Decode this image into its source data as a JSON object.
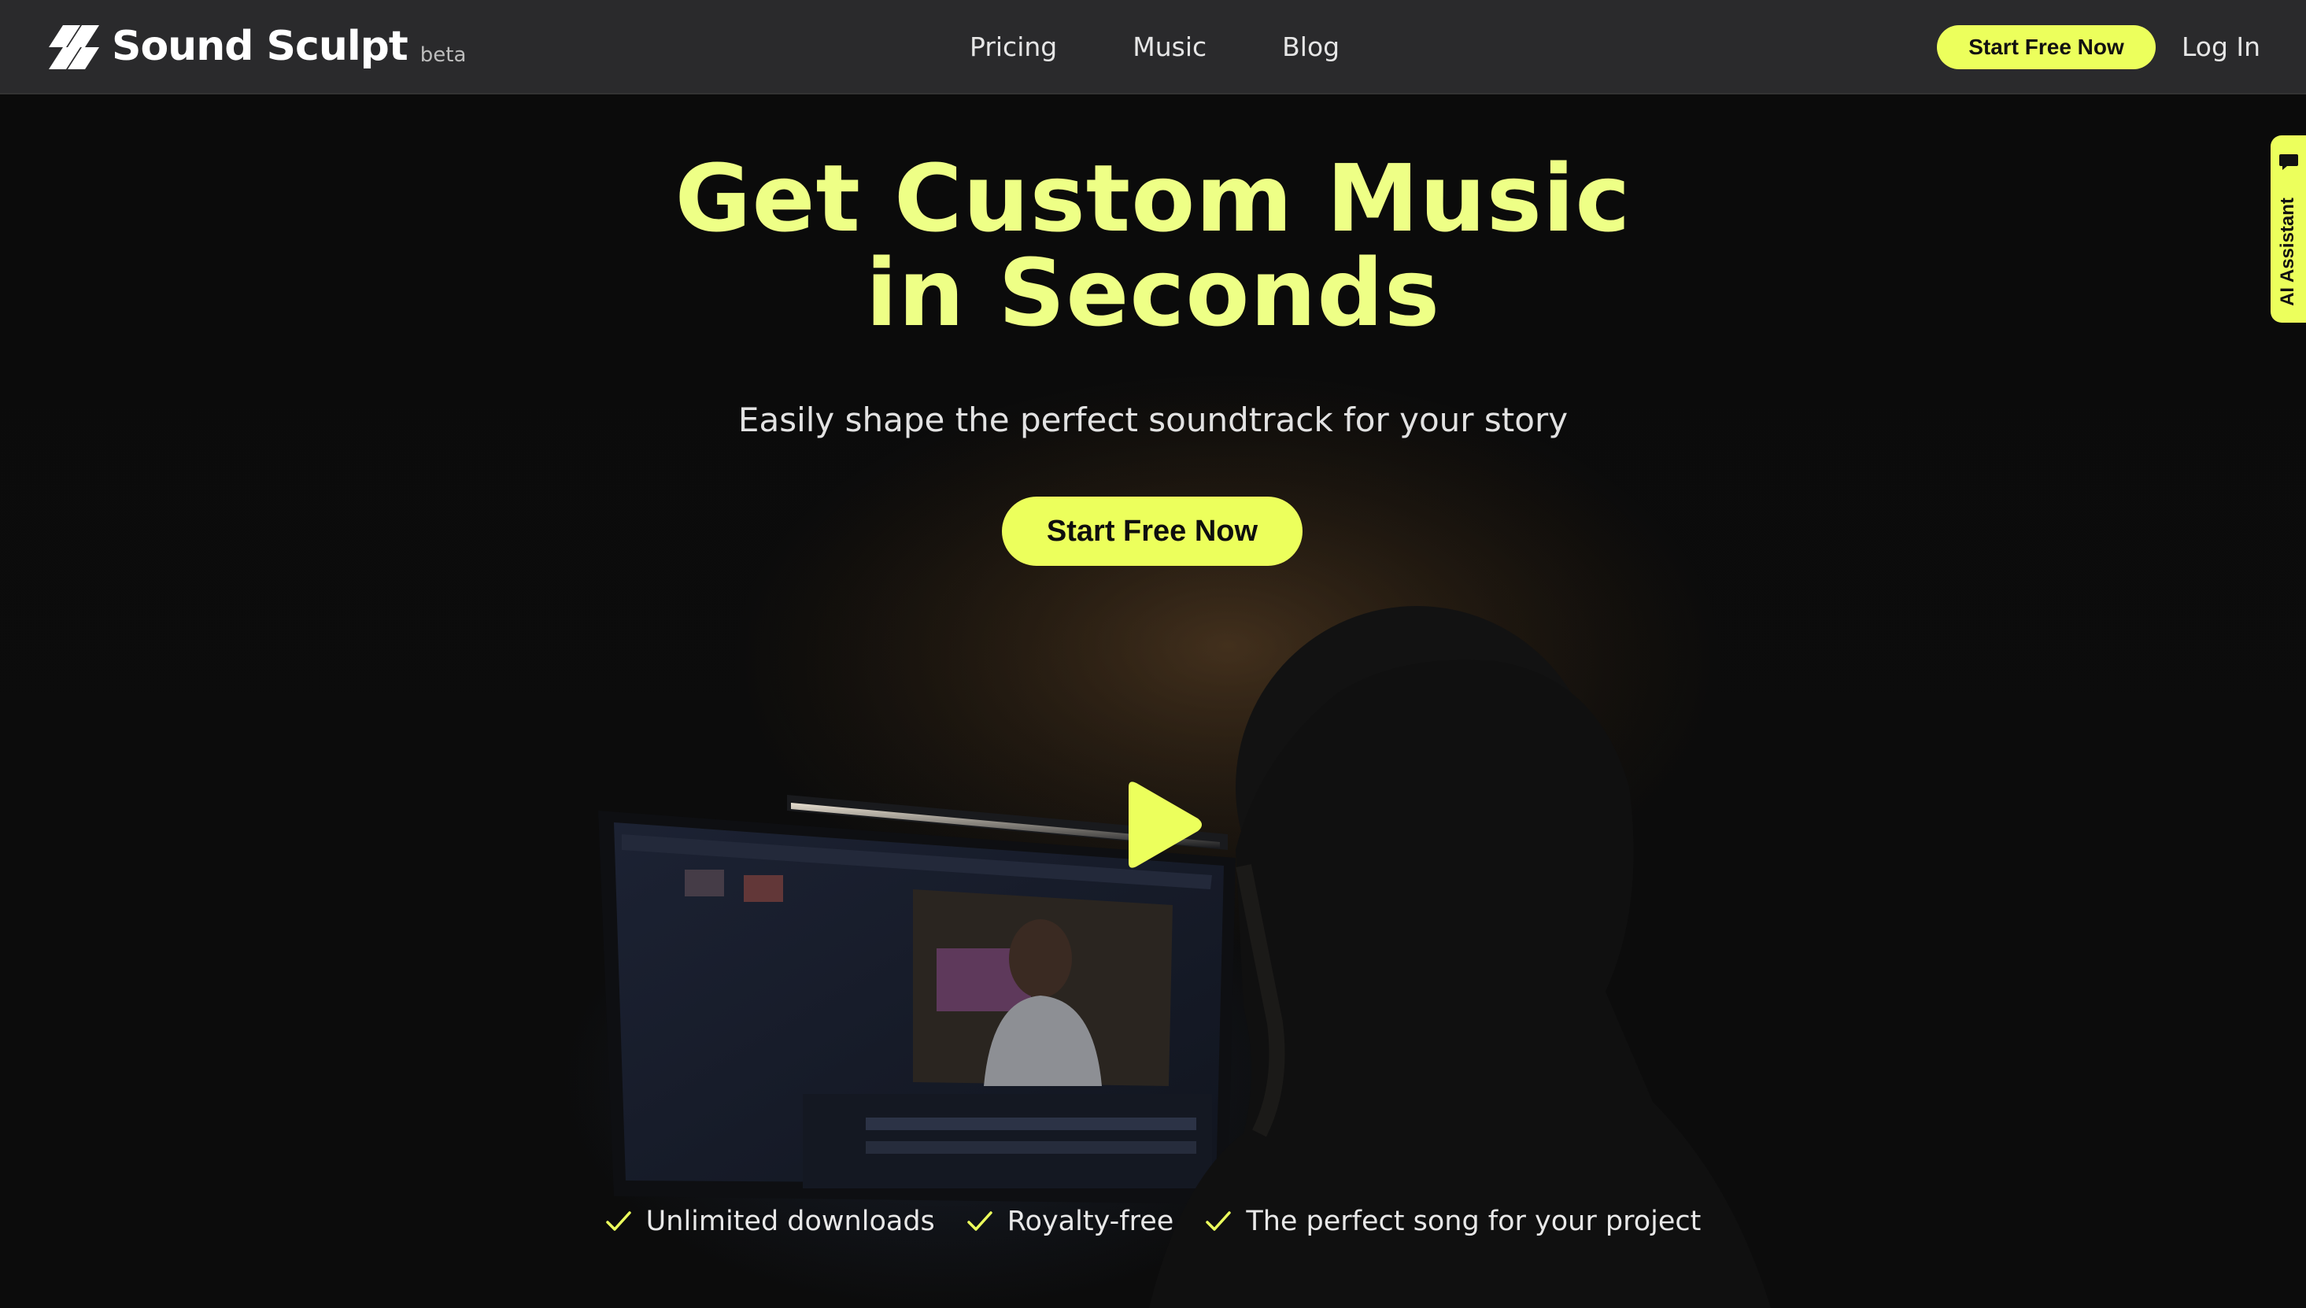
{
  "brand": {
    "name": "Sound Sculpt",
    "tag": "beta"
  },
  "nav": {
    "links": [
      "Pricing",
      "Music",
      "Blog"
    ],
    "cta": "Start Free Now",
    "login": "Log In"
  },
  "hero": {
    "title_line1": "Get Custom Music",
    "title_line2": "in Seconds",
    "subtitle": "Easily shape the perfect soundtrack for your story",
    "cta": "Start Free Now"
  },
  "features": [
    "Unlimited downloads",
    "Royalty-free",
    "The perfect song for your project"
  ],
  "side_tab": {
    "label": "AI Assistant"
  },
  "colors": {
    "accent": "#ecff5c",
    "title": "#eeff86",
    "nav_bg": "#2a2a2c",
    "page_bg": "#0a0a0a"
  }
}
